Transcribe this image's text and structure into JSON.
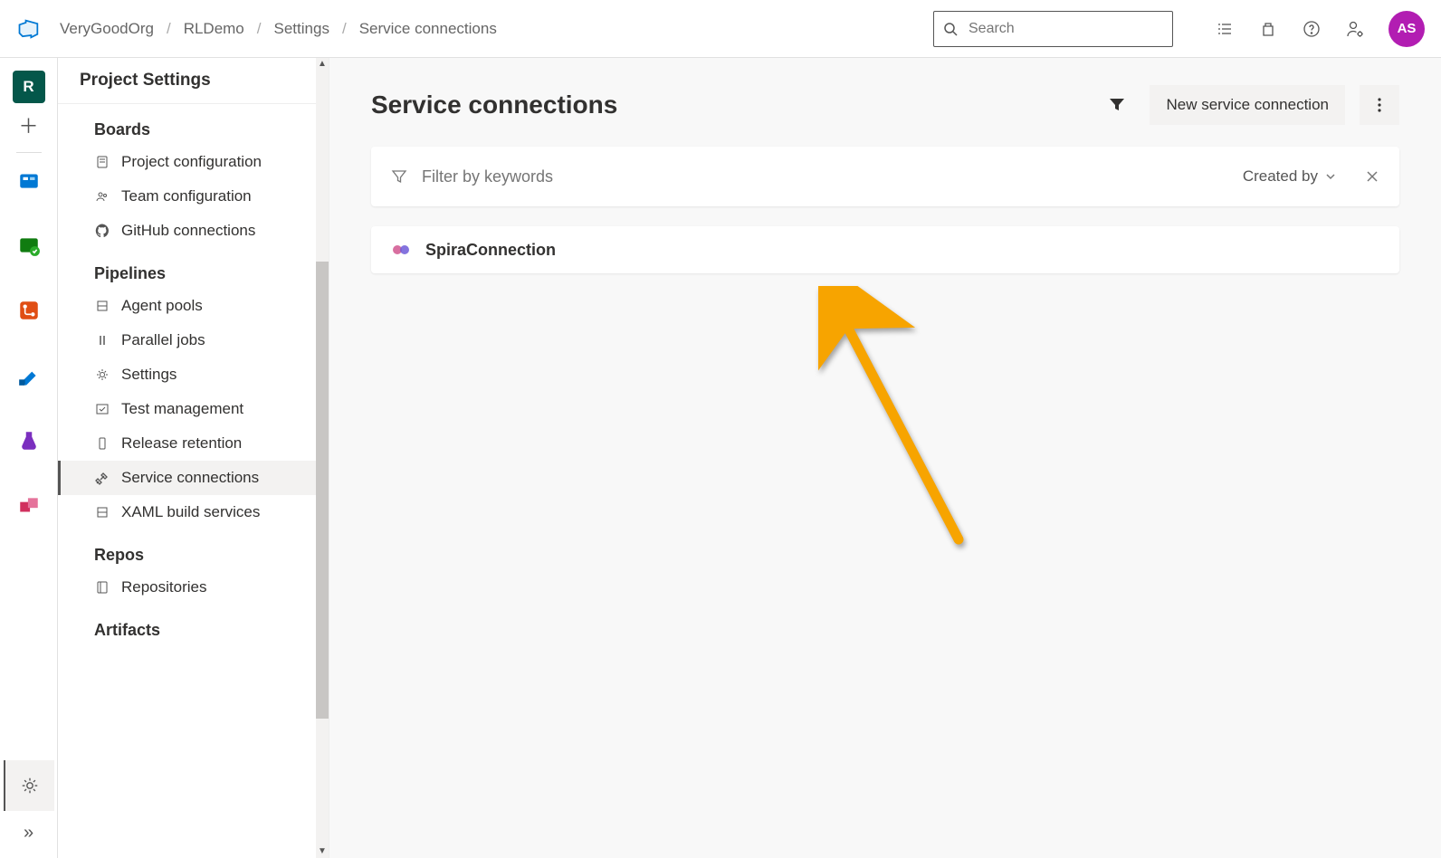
{
  "header": {
    "breadcrumb": [
      "VeryGoodOrg",
      "RLDemo",
      "Settings",
      "Service connections"
    ],
    "search_placeholder": "Search",
    "avatar_initials": "AS"
  },
  "rail": {
    "project_initial": "R"
  },
  "settings_nav": {
    "title": "Project Settings",
    "groups": [
      {
        "heading": "Boards",
        "items": [
          {
            "label": "Project configuration",
            "icon": "doc"
          },
          {
            "label": "Team configuration",
            "icon": "team"
          },
          {
            "label": "GitHub connections",
            "icon": "github"
          }
        ]
      },
      {
        "heading": "Pipelines",
        "items": [
          {
            "label": "Agent pools",
            "icon": "server"
          },
          {
            "label": "Parallel jobs",
            "icon": "parallel"
          },
          {
            "label": "Settings",
            "icon": "gear"
          },
          {
            "label": "Test management",
            "icon": "test"
          },
          {
            "label": "Release retention",
            "icon": "phone"
          },
          {
            "label": "Service connections",
            "icon": "plug",
            "active": true
          },
          {
            "label": "XAML build services",
            "icon": "server"
          }
        ]
      },
      {
        "heading": "Repos",
        "items": [
          {
            "label": "Repositories",
            "icon": "repo"
          }
        ]
      },
      {
        "heading": "Artifacts",
        "items": []
      }
    ]
  },
  "main": {
    "title": "Service connections",
    "new_button": "New service connection",
    "filter_placeholder": "Filter by keywords",
    "sort_label": "Created by",
    "connections": [
      {
        "name": "SpiraConnection"
      }
    ]
  }
}
